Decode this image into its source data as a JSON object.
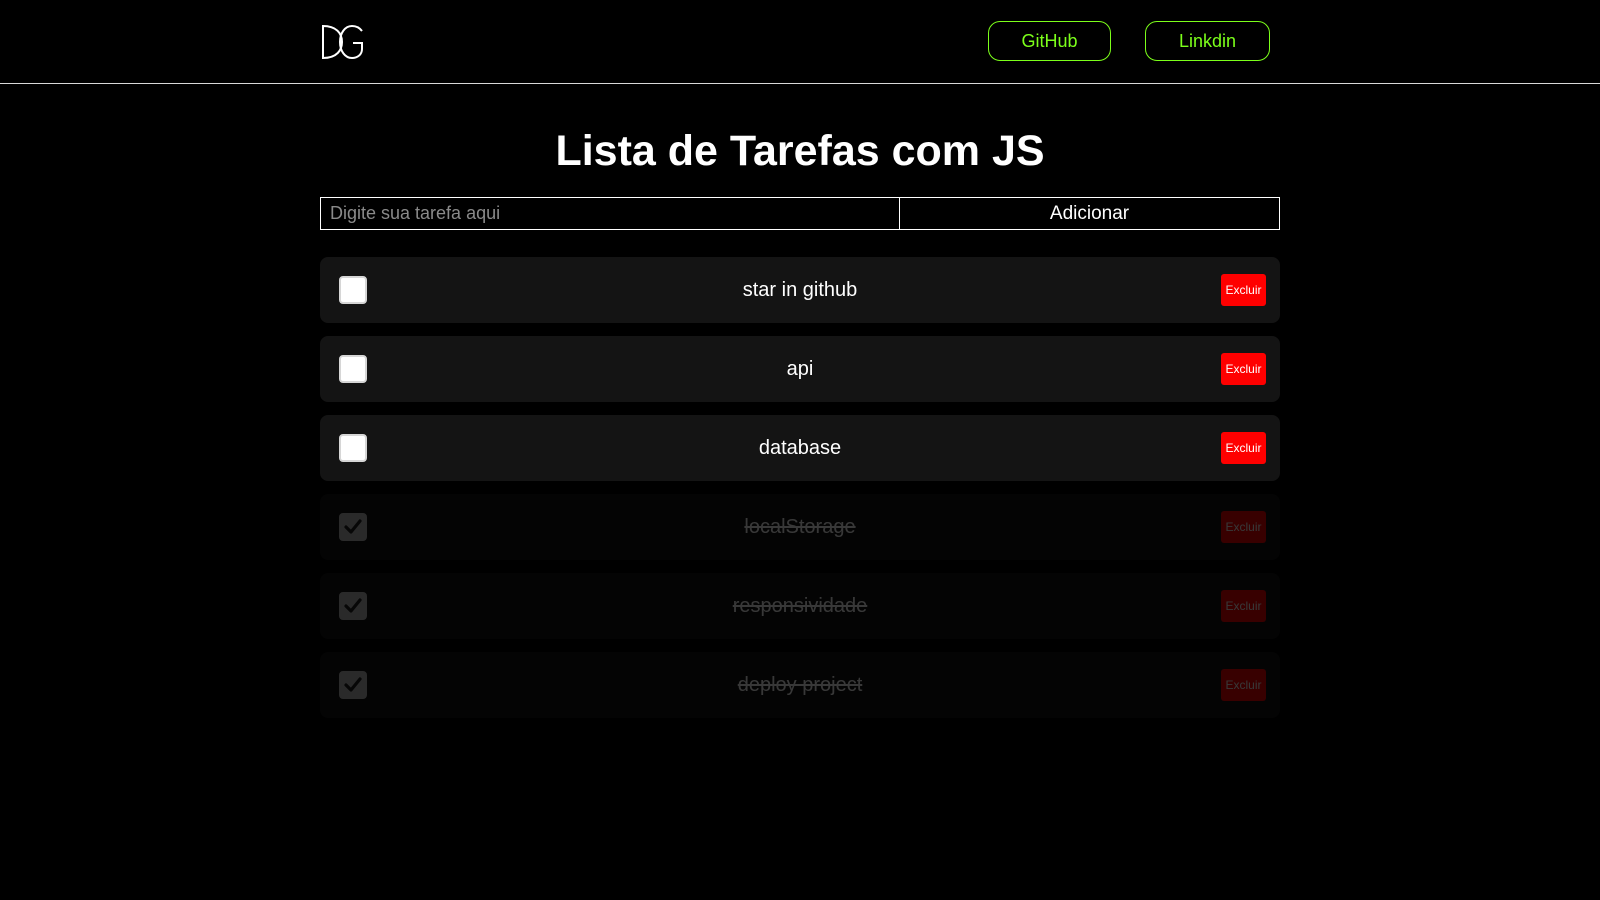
{
  "header": {
    "logo_text": "DG",
    "github_label": "GitHub",
    "linkedin_label": "Linkdin",
    "accent_color": "#7cff1a"
  },
  "main": {
    "title": "Lista de Tarefas com JS",
    "input_placeholder": "Digite sua tarefa aqui",
    "input_value": "",
    "add_button_label": "Adicionar"
  },
  "tasks": [
    {
      "label": "star in github",
      "done": false,
      "delete_label": "Excluir"
    },
    {
      "label": "api",
      "done": false,
      "delete_label": "Excluir"
    },
    {
      "label": "database",
      "done": false,
      "delete_label": "Excluir"
    },
    {
      "label": "localStorage",
      "done": true,
      "delete_label": "Excluir"
    },
    {
      "label": "responsividade",
      "done": true,
      "delete_label": "Excluir"
    },
    {
      "label": "deploy project",
      "done": true,
      "delete_label": "Excluir"
    }
  ],
  "colors": {
    "background": "#000000",
    "task_background": "#141414",
    "delete_button": "#ff0000"
  }
}
